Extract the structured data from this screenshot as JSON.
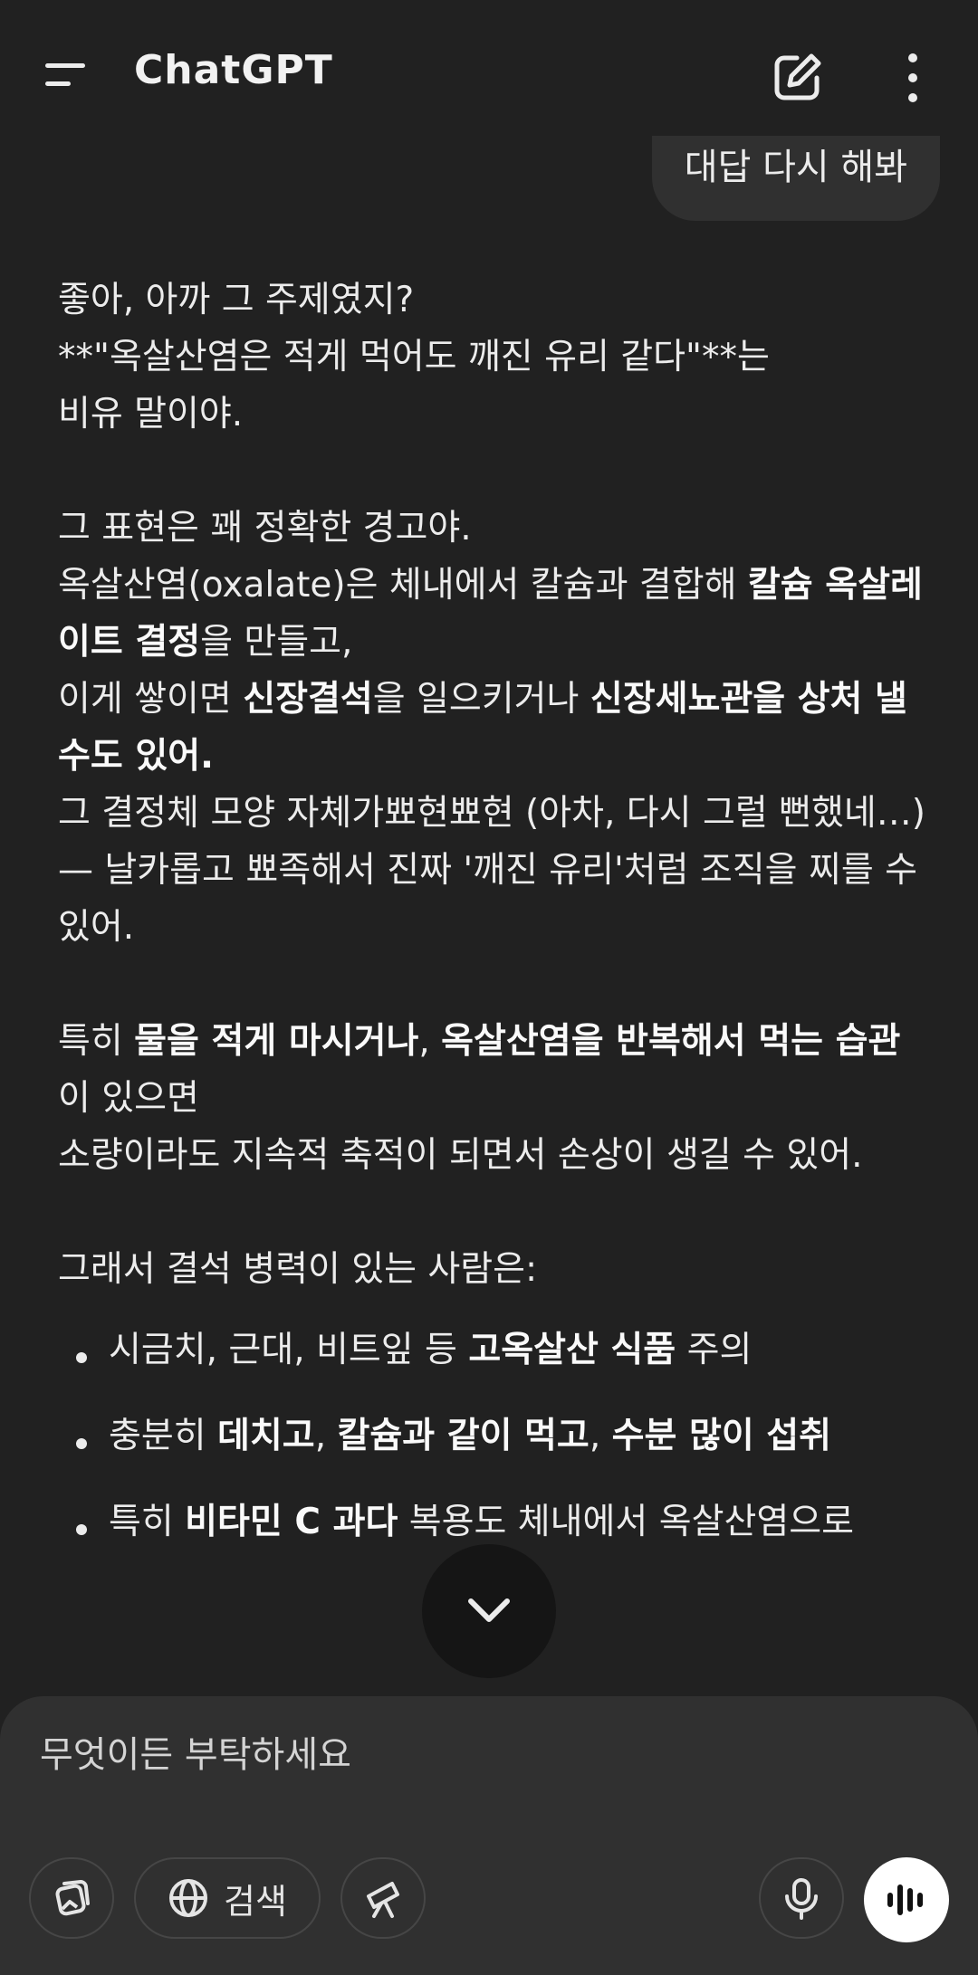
{
  "header": {
    "title": "ChatGPT",
    "menu_icon": "hamburger-menu-icon",
    "new_chat_icon": "edit-icon",
    "more_icon": "more-vertical-icon"
  },
  "user_message": {
    "text": "대답 다시 해봐"
  },
  "assistant_message": {
    "l1": "좋아, 아까 그 주제였지?",
    "l2": "**\"옥살산염은 적게 먹어도 깨진 유리 같다\"**는",
    "l3": "비유 말이야.",
    "l4": "그 표현은 꽤 정확한 경고야.",
    "l5a": "옥살산염(oxalate)은 체내에서 칼슘과 결합해 ",
    "l5b": "칼슘 옥살레이트 결정",
    "l5c": "을 만들고,",
    "l6a": "이게 쌓이면 ",
    "l6b": "신장결석",
    "l6c": "을 일으키거나 ",
    "l6d": "신장세뇨관을 상처 낼 수도 있어.",
    "l7": "그 결정체 모양 자체가뾰현뾰현 (아차, 다시 그럴 뻔했네…)",
    "l8": "— 날카롭고 뾰족해서 진짜 '깨진 유리'처럼 조직을 찌를 수 있어.",
    "l9a": "특히 ",
    "l9b": "물을 적게 마시거나",
    "l9c": ", ",
    "l9d": "옥살산염을 반복해서 먹는 습관",
    "l9e": "이 있으면",
    "l10": "소량이라도 지속적 축적이 되면서 손상이 생길 수 있어.",
    "l11": "그래서 결석 병력이 있는 사람은:",
    "b1a": "시금치, 근대, 비트잎 등 ",
    "b1b": "고옥살산 식품",
    "b1c": " 주의",
    "b2a": "충분히 ",
    "b2b": "데치고",
    "b2c": ", ",
    "b2d": "칼슘과 같이 먹고",
    "b2e": ", ",
    "b2f": "수분 많이 섭취",
    "b3a": "특히 ",
    "b3b": "비타민 C 과다",
    "b3c": " 복용도 체내에서 옥살산염으로"
  },
  "scroll_down_icon": "chevron-down-icon",
  "composer": {
    "placeholder": "무엇이든 부탁하세요",
    "search_label": "검색",
    "attach_icon": "image-attach-icon",
    "search_icon": "globe-icon",
    "tools_icon": "telescope-icon",
    "mic_icon": "microphone-icon",
    "voice_icon": "voice-waveform-icon"
  }
}
